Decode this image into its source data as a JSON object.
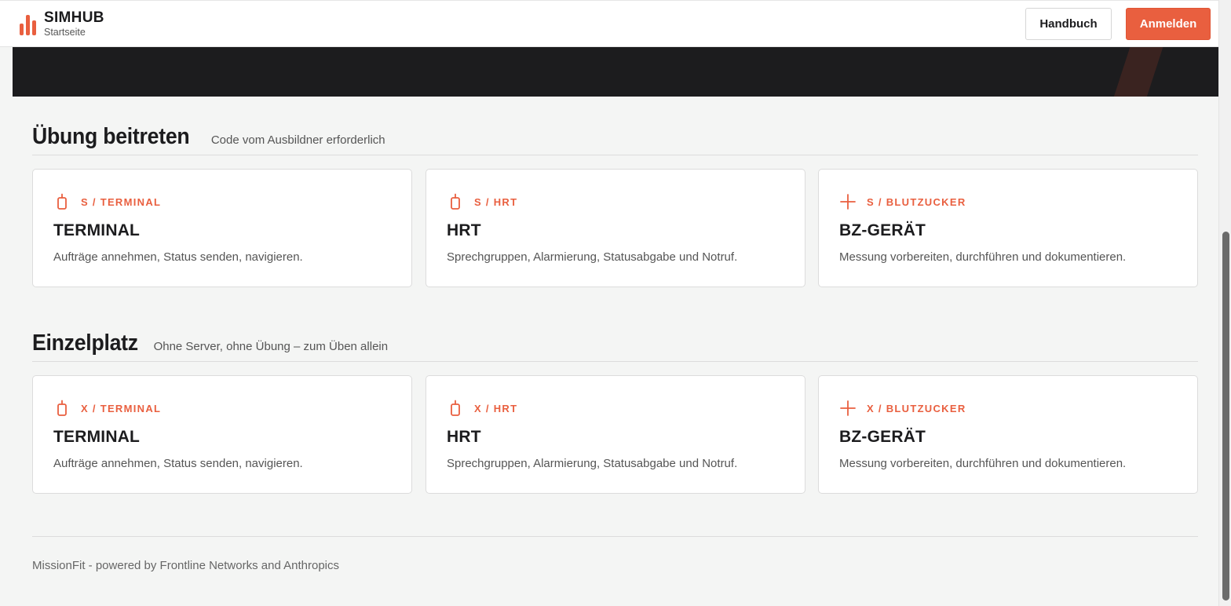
{
  "header": {
    "brand_name": "SIMHUB",
    "brand_sub": "Startseite",
    "manual_label": "Handbuch",
    "login_label": "Anmelden",
    "logo_icon": "bar-chart-icon"
  },
  "colors": {
    "accent": "#e95f3f",
    "hero_bg": "#1c1c1e",
    "page_bg": "#f4f5f4"
  },
  "sections": [
    {
      "title": "Übung beitreten",
      "subtitle": "Code vom Ausbildner erforderlich",
      "cards": [
        {
          "icon": "radio-icon",
          "kicker": "S / TERMINAL",
          "title": "TERMINAL",
          "desc": "Aufträge annehmen, Status senden, navigieren."
        },
        {
          "icon": "radio-icon",
          "kicker": "S / HRT",
          "title": "HRT",
          "desc": "Sprechgruppen, Alarmierung, Statusabgabe und Notruf."
        },
        {
          "icon": "plus-icon",
          "kicker": "S / BLUTZUCKER",
          "title": "BZ-GERÄT",
          "desc": "Messung vorbereiten, durchführen und dokumentieren."
        }
      ]
    },
    {
      "title": "Einzelplatz",
      "subtitle": "Ohne Server, ohne Übung – zum Üben allein",
      "cards": [
        {
          "icon": "radio-icon",
          "kicker": "X / TERMINAL",
          "title": "TERMINAL",
          "desc": "Aufträge annehmen, Status senden, navigieren."
        },
        {
          "icon": "radio-icon",
          "kicker": "X / HRT",
          "title": "HRT",
          "desc": "Sprechgruppen, Alarmierung, Statusabgabe und Notruf."
        },
        {
          "icon": "plus-icon",
          "kicker": "X / BLUTZUCKER",
          "title": "BZ-GERÄT",
          "desc": "Messung vorbereiten, durchführen und dokumentieren."
        }
      ]
    }
  ],
  "footer": {
    "text": "MissionFit - powered by Frontline Networks and Anthropics"
  }
}
